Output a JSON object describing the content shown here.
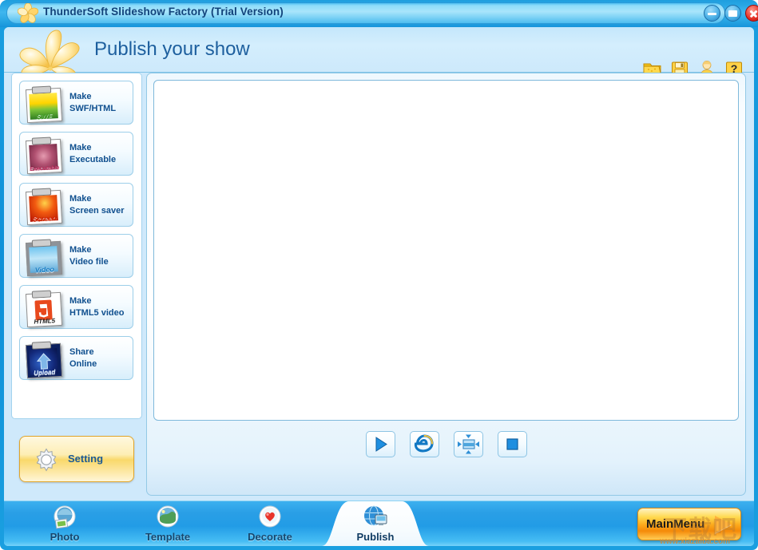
{
  "window": {
    "title": "ThunderSoft Slideshow Factory (Trial Version)",
    "app_icon": "flower-icon",
    "controls": {
      "minimize": "minimize-button",
      "maximize": "maximize-button",
      "close": "close-button"
    }
  },
  "header": {
    "title": "Publish your show",
    "logo_icon": "flower-logo-icon",
    "toolbar": [
      {
        "name": "open-folder-icon",
        "label": "Open"
      },
      {
        "name": "save-icon",
        "label": "Save"
      },
      {
        "name": "user-icon",
        "label": "User"
      },
      {
        "name": "help-icon",
        "label": "Help"
      }
    ]
  },
  "sidebar": {
    "items": [
      {
        "line1": "Make",
        "line2": "SWF/HTML",
        "caption": "SWF",
        "icon": "swf-thumbnail-icon"
      },
      {
        "line1": "Make",
        "line2": "Executable",
        "caption": "Executable",
        "icon": "executable-thumbnail-icon"
      },
      {
        "line1": "Make",
        "line2": "Screen saver",
        "caption": "Screen",
        "icon": "screensaver-thumbnail-icon"
      },
      {
        "line1": "Make",
        "line2": "Video file",
        "caption": "Video",
        "icon": "video-thumbnail-icon"
      },
      {
        "line1": "Make",
        "line2": "HTML5 video",
        "caption": "HTML5",
        "icon": "html5-thumbnail-icon"
      },
      {
        "line1": "Share",
        "line2": "Online",
        "caption": "Upload",
        "icon": "upload-thumbnail-icon"
      }
    ],
    "setting": {
      "label": "Setting",
      "icon": "gear-icon"
    }
  },
  "preview": {
    "stage_content": "",
    "controls": [
      {
        "name": "play-button",
        "icon": "play-icon"
      },
      {
        "name": "browser-button",
        "icon": "internet-explorer-icon"
      },
      {
        "name": "fullscreen-button",
        "icon": "fullscreen-icon"
      },
      {
        "name": "stop-button",
        "icon": "stop-icon"
      }
    ]
  },
  "bottom_nav": {
    "tabs": [
      {
        "label": "Photo",
        "icon": "photo-icon",
        "active": false
      },
      {
        "label": "Template",
        "icon": "template-icon",
        "active": false
      },
      {
        "label": "Decorate",
        "icon": "decorate-icon",
        "active": false
      },
      {
        "label": "Publish",
        "icon": "publish-icon",
        "active": true
      }
    ],
    "main_menu": {
      "label": "MainMenu",
      "icon": "arrow-right-icon"
    }
  },
  "watermark": {
    "url": "www.xiazaiba.com",
    "text": "下载吧"
  },
  "colors": {
    "frame_blue": "#1a9fe0",
    "title_plate": "#8edcfa",
    "panel_bg": "#cfe9fb",
    "accent_gold": "#f9d86a",
    "mainmenu_orange": "#fcaa1c",
    "label_blue": "#10508f",
    "close_red": "#e8362b"
  }
}
